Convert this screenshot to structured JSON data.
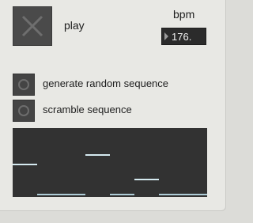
{
  "transport": {
    "toggle_icon": "x-close-icon",
    "play_label": "play"
  },
  "tempo": {
    "label": "bpm",
    "value": "176."
  },
  "options": [
    {
      "label": "generate random sequence",
      "icon": "radio-circle-icon"
    },
    {
      "label": "scramble sequence",
      "icon": "radio-circle-icon"
    }
  ],
  "sequence": {
    "steps": 8,
    "value_range": [
      0,
      1
    ],
    "values": [
      0.5,
      0,
      0,
      0.65,
      0,
      0.25,
      0,
      0
    ],
    "colors": {
      "background": "#323232",
      "active_line": "#d5eaf0",
      "base_line": "#aeccd6"
    }
  },
  "colors": {
    "panel": "#e8e8e4",
    "button": "#4a4a4a",
    "number_box": "#2b2b2b"
  }
}
